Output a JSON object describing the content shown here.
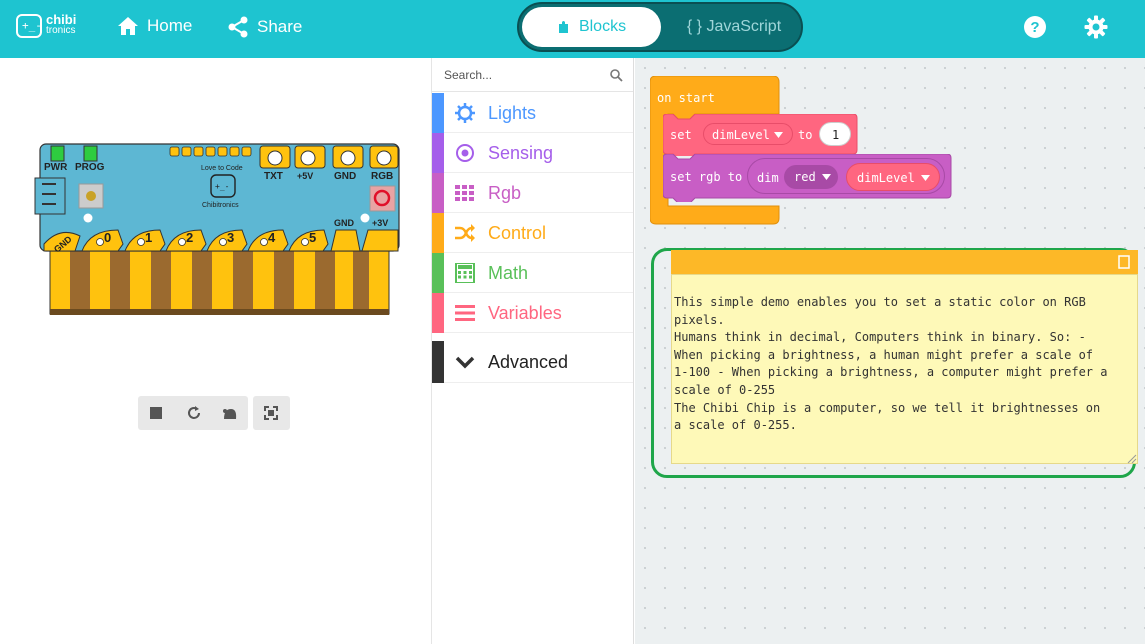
{
  "header": {
    "logo_text": "chibi",
    "logo_subtext": "tronics",
    "home_label": "Home",
    "share_label": "Share",
    "blocks_label": "Blocks",
    "javascript_label": "{ } JavaScript",
    "help_icon": "help-icon",
    "settings_icon": "gear-icon"
  },
  "simulator": {
    "board_labels": {
      "pwr": "PWR",
      "prog": "PROG",
      "love": "Love to Code",
      "brand": "Chibitronics",
      "txt": "TXT",
      "plus5v": "+5V",
      "gnd_top": "GND",
      "rgb": "RGB",
      "gnd_mid": "GND",
      "plus3v": "+3V",
      "gnd_pad": "GND",
      "pins": [
        "0",
        "1",
        "2",
        "3",
        "4",
        "5"
      ]
    },
    "controls": [
      "stop-icon",
      "restart-icon",
      "slow-motion-icon",
      "fullscreen-icon"
    ]
  },
  "toolbox": {
    "search_placeholder": "Search...",
    "categories": [
      {
        "label": "Lights",
        "color": "#4C97FF"
      },
      {
        "label": "Sensing",
        "color": "#A55EEA"
      },
      {
        "label": "Rgb",
        "color": "#C85EC5"
      },
      {
        "label": "Control",
        "color": "#FFAB19"
      },
      {
        "label": "Math",
        "color": "#59C059"
      },
      {
        "label": "Variables",
        "color": "#FF6680"
      }
    ],
    "advanced_label": "Advanced"
  },
  "workspace": {
    "on_start": "on start",
    "set_label": "set",
    "variable_name": "dimLevel",
    "to_label": "to",
    "set_value": "1",
    "set_rgb_label": "set rgb to",
    "dim_label": "dim",
    "color_option": "red",
    "dim_variable": "dimLevel",
    "comment_lines": [
      "This simple demo enables you to set a static color on RGB pixels.",
      "Humans think in decimal, Computers think in binary. So: - When picking a brightness, a human might prefer a scale of 1-100 - When picking a brightness, a computer might prefer a scale of 0-255",
      "The Chibi Chip is a computer, so we tell it brightnesses on a scale of 0-255."
    ],
    "colors": {
      "event_block": "#FFAB19",
      "variable_block": "#FF6680",
      "rgb_block": "#C85EC5",
      "comment_header": "#FDB827",
      "comment_body": "#FEF9B8",
      "highlight": "#1FA64A"
    }
  }
}
